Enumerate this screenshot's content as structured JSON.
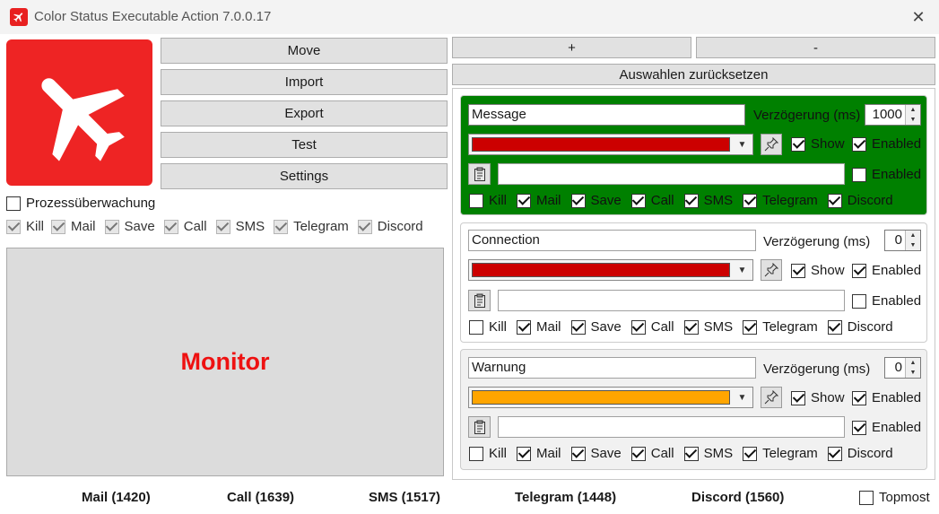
{
  "window": {
    "title": "Color Status Executable Action 7.0.0.17",
    "close_symbol": "✕"
  },
  "colors": {
    "logo_red": "#ee2424",
    "message_bg": "#008000",
    "red_status": "#cc0000",
    "orange_status": "#ffa500",
    "monitor_text": "#ee1111"
  },
  "left_buttons": {
    "move": "Move",
    "import": "Import",
    "export": "Export",
    "test": "Test",
    "settings": "Settings"
  },
  "process_monitoring": {
    "label": "Prozessüberwachung",
    "checked": false
  },
  "global_options": [
    {
      "label": "Kill",
      "checked": true
    },
    {
      "label": "Mail",
      "checked": true
    },
    {
      "label": "Save",
      "checked": true
    },
    {
      "label": "Call",
      "checked": true
    },
    {
      "label": "SMS",
      "checked": true
    },
    {
      "label": "Telegram",
      "checked": true
    },
    {
      "label": "Discord",
      "checked": true
    }
  ],
  "monitor": {
    "label": "Monitor"
  },
  "top_right": {
    "plus": "+",
    "minus": "-",
    "reset": "Auswahlen zurücksetzen"
  },
  "cards": [
    {
      "name": "Message",
      "delay_label": "Verzögerung (ms)",
      "delay_value": "1000",
      "color": "#cc0000",
      "show_label": "Show",
      "show": true,
      "enabled_label": "Enabled",
      "enabled": true,
      "exec_path": "",
      "exec_enabled_label": "Enabled",
      "exec_enabled": false,
      "options": [
        {
          "label": "Kill",
          "checked": false
        },
        {
          "label": "Mail",
          "checked": true
        },
        {
          "label": "Save",
          "checked": true
        },
        {
          "label": "Call",
          "checked": true
        },
        {
          "label": "SMS",
          "checked": true
        },
        {
          "label": "Telegram",
          "checked": true
        },
        {
          "label": "Discord",
          "checked": true
        }
      ]
    },
    {
      "name": "Connection",
      "delay_label": "Verzögerung (ms)",
      "delay_value": "0",
      "color": "#cc0000",
      "show_label": "Show",
      "show": true,
      "enabled_label": "Enabled",
      "enabled": true,
      "exec_path": "",
      "exec_enabled_label": "Enabled",
      "exec_enabled": false,
      "options": [
        {
          "label": "Kill",
          "checked": false
        },
        {
          "label": "Mail",
          "checked": true
        },
        {
          "label": "Save",
          "checked": true
        },
        {
          "label": "Call",
          "checked": true
        },
        {
          "label": "SMS",
          "checked": true
        },
        {
          "label": "Telegram",
          "checked": true
        },
        {
          "label": "Discord",
          "checked": true
        }
      ]
    },
    {
      "name": "Warnung",
      "delay_label": "Verzögerung (ms)",
      "delay_value": "0",
      "color": "#ffa500",
      "show_label": "Show",
      "show": true,
      "enabled_label": "Enabled",
      "enabled": true,
      "exec_path": "",
      "exec_enabled_label": "Enabled",
      "exec_enabled": true,
      "options": [
        {
          "label": "Kill",
          "checked": false
        },
        {
          "label": "Mail",
          "checked": true
        },
        {
          "label": "Save",
          "checked": true
        },
        {
          "label": "Call",
          "checked": true
        },
        {
          "label": "SMS",
          "checked": true
        },
        {
          "label": "Telegram",
          "checked": true
        },
        {
          "label": "Discord",
          "checked": true
        }
      ]
    }
  ],
  "stats": {
    "mail": "Mail (1420)",
    "call": "Call (1639)",
    "sms": "SMS (1517)",
    "telegram": "Telegram (1448)",
    "discord": "Discord (1560)"
  },
  "topmost": {
    "label": "Topmost",
    "checked": false
  }
}
